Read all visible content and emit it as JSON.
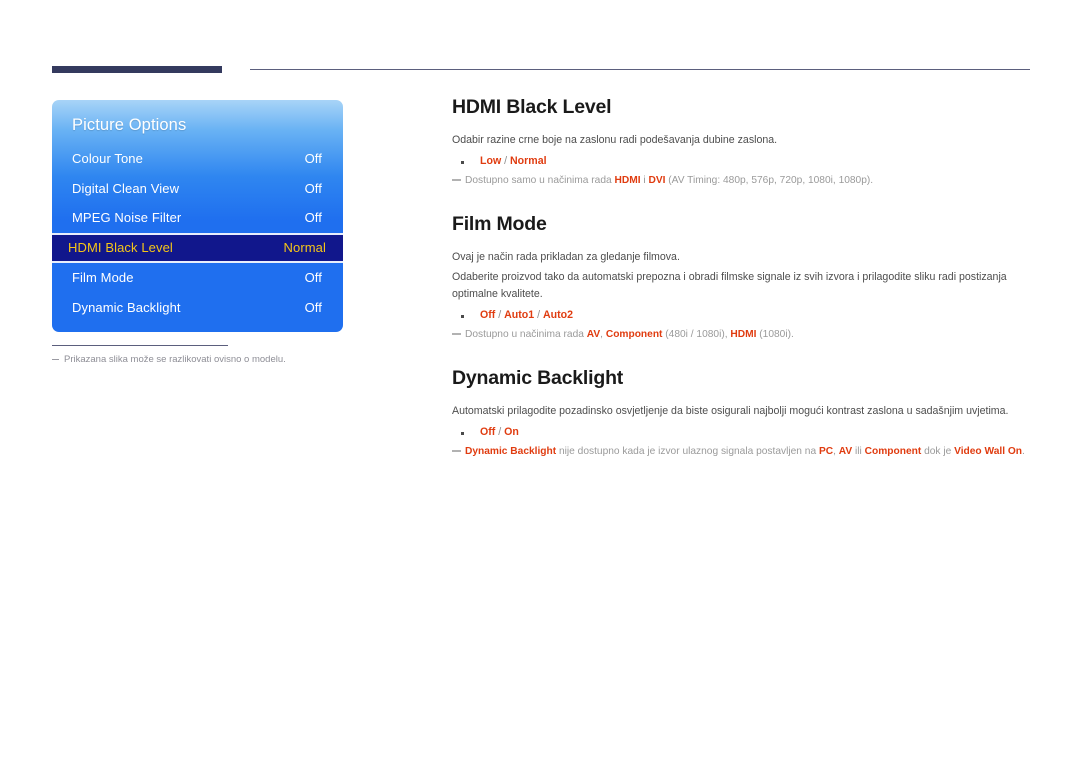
{
  "header": {
    "bar_accent_color": "#343a5e",
    "rule_color": "#5b5f7d"
  },
  "osd": {
    "title": "Picture Options",
    "selected_index": 3,
    "highlight_bg": "#11178c",
    "highlight_text": "#f5c518",
    "panel_color_top": "#a8d4f7",
    "panel_color_bottom": "#1f6fef",
    "rows": [
      {
        "label": "Colour Tone",
        "value": "Off"
      },
      {
        "label": "Digital Clean View",
        "value": "Off"
      },
      {
        "label": "MPEG Noise Filter",
        "value": "Off"
      },
      {
        "label": "HDMI Black Level",
        "value": "Normal"
      },
      {
        "label": "Film Mode",
        "value": "Off"
      },
      {
        "label": "Dynamic Backlight",
        "value": "Off"
      }
    ]
  },
  "caption": {
    "text": "Prikazana slika može se razlikovati ovisno o modelu."
  },
  "article": {
    "accent_color": "#e03c10",
    "sections": [
      {
        "heading": "HDMI Black Level",
        "paragraphs": [
          "Odabir razine crne boje na zaslonu radi podešavanja dubine zaslona."
        ],
        "options": [
          {
            "text": "Low",
            "accent": true
          },
          {
            "text": " / ",
            "accent": false
          },
          {
            "text": "Normal",
            "accent": true
          }
        ],
        "note": [
          {
            "text": "Dostupno samo u načinima rada ",
            "accent": false
          },
          {
            "text": "HDMI",
            "accent": true
          },
          {
            "text": " i ",
            "accent": false
          },
          {
            "text": "DVI",
            "accent": true
          },
          {
            "text": " (AV Timing: 480p, 576p, 720p, 1080i, 1080p).",
            "accent": false
          }
        ]
      },
      {
        "heading": "Film Mode",
        "paragraphs": [
          "Ovaj je način rada prikladan za gledanje filmova.",
          "Odaberite proizvod tako da automatski prepozna i obradi filmske signale iz svih izvora i prilagodite sliku radi postizanja optimalne kvalitete."
        ],
        "options": [
          {
            "text": "Off",
            "accent": true
          },
          {
            "text": " / ",
            "accent": false
          },
          {
            "text": "Auto1",
            "accent": true
          },
          {
            "text": " / ",
            "accent": false
          },
          {
            "text": "Auto2",
            "accent": true
          }
        ],
        "note": [
          {
            "text": "Dostupno u načinima rada ",
            "accent": false
          },
          {
            "text": "AV",
            "accent": true
          },
          {
            "text": ", ",
            "accent": false
          },
          {
            "text": "Component",
            "accent": true
          },
          {
            "text": " (480i / 1080i), ",
            "accent": false
          },
          {
            "text": "HDMI",
            "accent": true
          },
          {
            "text": " (1080i).",
            "accent": false
          }
        ]
      },
      {
        "heading": "Dynamic Backlight",
        "paragraphs": [
          "Automatski prilagodite pozadinsko osvjetljenje da biste osigurali najbolji mogući kontrast zaslona u sadašnjim uvjetima."
        ],
        "options": [
          {
            "text": "Off",
            "accent": true
          },
          {
            "text": " / ",
            "accent": false
          },
          {
            "text": "On",
            "accent": true
          }
        ],
        "note": [
          {
            "text": "Dynamic Backlight",
            "accent": true
          },
          {
            "text": " nije dostupno kada je izvor ulaznog signala postavljen na ",
            "accent": false
          },
          {
            "text": "PC",
            "accent": true
          },
          {
            "text": ", ",
            "accent": false
          },
          {
            "text": "AV",
            "accent": true
          },
          {
            "text": " ili ",
            "accent": false
          },
          {
            "text": "Component",
            "accent": true
          },
          {
            "text": " dok je ",
            "accent": false
          },
          {
            "text": "Video Wall On",
            "accent": true
          },
          {
            "text": ".",
            "accent": false
          }
        ]
      }
    ]
  }
}
